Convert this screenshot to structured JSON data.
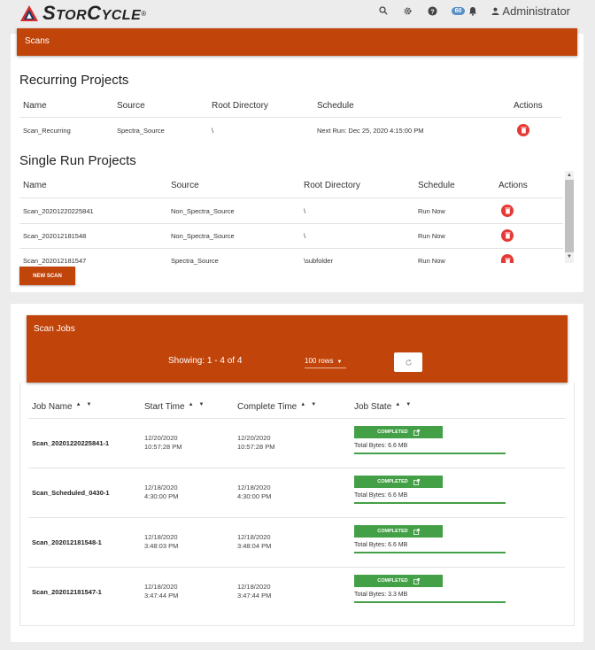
{
  "app": {
    "logo_text_big": "S",
    "logo_text_rest": "TOR",
    "logo_text_big2": "C",
    "logo_text_rest2": "YCLE",
    "logo_reg": "®"
  },
  "topbar": {
    "badge": "60",
    "user": "Administrator"
  },
  "icons": {
    "search": "search-icon",
    "settings": "gear-icon",
    "help": "help-icon",
    "notifications": "bell-icon",
    "user": "person-icon"
  },
  "colors": {
    "accent": "#c1440a",
    "delete": "#e53935",
    "completed": "#43a047"
  },
  "scans": {
    "title": "Scans",
    "recurring": {
      "heading": "Recurring Projects",
      "columns": [
        "Name",
        "Source",
        "Root Directory",
        "Schedule",
        "Actions"
      ],
      "rows": [
        {
          "name": "Scan_Recurring",
          "source": "Spectra_Source",
          "root": "\\",
          "schedule": "Next Run: Dec 25, 2020 4:15:00 PM"
        }
      ]
    },
    "single": {
      "heading": "Single Run Projects",
      "columns": [
        "Name",
        "Source",
        "Root Directory",
        "Schedule",
        "Actions"
      ],
      "rows": [
        {
          "name": "Scan_20201220225841",
          "source": "Non_Spectra_Source",
          "root": "\\",
          "schedule": "Run Now"
        },
        {
          "name": "Scan_202012181548",
          "source": "Non_Spectra_Source",
          "root": "\\",
          "schedule": "Run Now"
        },
        {
          "name": "Scan_202012181547",
          "source": "Spectra_Source",
          "root": "\\subfolder",
          "schedule": "Run Now"
        }
      ]
    },
    "new_scan_label": "NEW SCAN"
  },
  "jobs": {
    "title": "Scan Jobs",
    "showing": "Showing: 1 - 4 of 4",
    "rows_select": "100 rows",
    "refresh_icon": "refresh-icon",
    "columns": [
      "Job Name",
      "Start Time",
      "Complete Time",
      "Job State"
    ],
    "rows": [
      {
        "name": "Scan_20201220225841-1",
        "start_date": "12/20/2020",
        "start_time": "10:57:28 PM",
        "complete_date": "12/20/2020",
        "complete_time": "10:57:28 PM",
        "state": "COMPLETED",
        "bytes": "Total Bytes: 6.6 MB",
        "progress": 1.0
      },
      {
        "name": "Scan_Scheduled_0430-1",
        "start_date": "12/18/2020",
        "start_time": "4:30:00 PM",
        "complete_date": "12/18/2020",
        "complete_time": "4:30:00 PM",
        "state": "COMPLETED",
        "bytes": "Total Bytes: 6.6 MB",
        "progress": 1.0
      },
      {
        "name": "Scan_202012181548-1",
        "start_date": "12/18/2020",
        "start_time": "3:48:03 PM",
        "complete_date": "12/18/2020",
        "complete_time": "3:48:04 PM",
        "state": "COMPLETED",
        "bytes": "Total Bytes: 6.6 MB",
        "progress": 1.0
      },
      {
        "name": "Scan_202012181547-1",
        "start_date": "12/18/2020",
        "start_time": "3:47:44 PM",
        "complete_date": "12/18/2020",
        "complete_time": "3:47:44 PM",
        "state": "COMPLETED",
        "bytes": "Total Bytes: 3.3 MB",
        "progress": 1.0
      }
    ]
  }
}
